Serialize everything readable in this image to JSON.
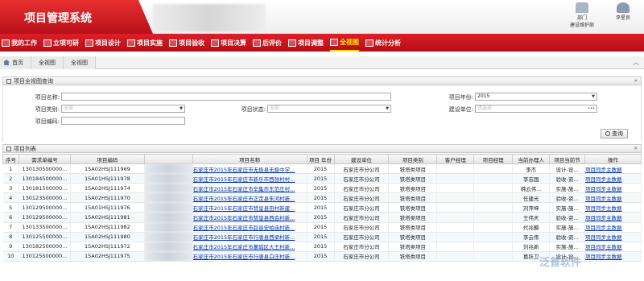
{
  "app": {
    "title": "项目管理系统"
  },
  "top_links": [
    {
      "label": "部门",
      "sub": "建设维护部"
    },
    {
      "label": "李星良",
      "sub": ""
    }
  ],
  "nav": [
    {
      "label": "我的工作"
    },
    {
      "label": "立项可研"
    },
    {
      "label": "项目设计"
    },
    {
      "label": "项目实施"
    },
    {
      "label": "项目验收"
    },
    {
      "label": "项目决算"
    },
    {
      "label": "后评价"
    },
    {
      "label": "项目调整"
    },
    {
      "label": "全视图"
    },
    {
      "label": "统计分析"
    }
  ],
  "breadcrumb": {
    "home": "首页",
    "tab1": "全视图",
    "tab2": "全视图"
  },
  "query": {
    "title": "项目全视图查询",
    "name_label": "项目名称:",
    "type_label": "项目类别:",
    "type_value": "全部",
    "status_label": "项目状态:",
    "status_value": "全部",
    "code_label": "项目编码:",
    "year_label": "项目年份:",
    "year_value": "2015",
    "unit_label": "建设单位:",
    "unit_placeholder": "请选择",
    "button": "查询"
  },
  "table": {
    "title": "项目列表",
    "columns": [
      "序号",
      "需求单编号",
      "项目编码",
      "",
      "项目名称",
      "项目 年份",
      "建设单位",
      "项目类别",
      "客户经理",
      "项目经理",
      "当前办理人",
      "项目当前节",
      "操作"
    ],
    "rows": [
      [
        "1",
        "130130500000...",
        "15A02HSJ111969",
        "",
        "石家庄市2015年石家庄市无极县无极中学...",
        "2015",
        "石家庄市分公司",
        "铁塔类项目",
        "",
        "",
        "李杰",
        "设计-设...",
        "项目同步主数据"
      ],
      [
        "2",
        "130184500000...",
        "15A01HSJ111978",
        "",
        "石家庄市2015年石家庄市新乐市西张村村...",
        "2015",
        "石家庄市分公司",
        "铁塔类项目",
        "",
        "",
        "李志国",
        "验收-资...",
        "项目同步主数据"
      ],
      [
        "3",
        "130181500000...",
        "15A02HSJ111974",
        "",
        "石家庄市2015年石家庄市辛集市东范庄村...",
        "2015",
        "石家庄市分公司",
        "铁塔类项目",
        "",
        "",
        "韩云伟...",
        "实施-施...",
        "项目同步主数据"
      ],
      [
        "4",
        "130123500000...",
        "15A02HSJ111970",
        "",
        "石家庄市2015年石家庄市正定县朱河村新...",
        "2015",
        "石家庄市分公司",
        "铁塔类项目",
        "",
        "",
        "任建光",
        "验收-资...",
        "项目同步主数据"
      ],
      [
        "5",
        "130129500000...",
        "15A01HSJ111976",
        "",
        "石家庄市2015年石家庄市赞皇县田村新建...",
        "2015",
        "石家庄市分公司",
        "铁塔类项目",
        "",
        "",
        "刘萍坤",
        "实施-施...",
        "项目同步主数据"
      ],
      [
        "6",
        "130129500000...",
        "15A02HSJ111981",
        "",
        "石家庄市2015年石家庄市赞皇县西会村新...",
        "2015",
        "石家庄市分公司",
        "铁塔类项目",
        "",
        "",
        "王伟天",
        "验收-资...",
        "项目同步主数据"
      ],
      [
        "7",
        "130133500000...",
        "15A02HSJ111982",
        "",
        "石家庄市2015年石家庄市赵县安柏庙村新...",
        "2015",
        "石家庄市分公司",
        "铁塔类项目",
        "",
        "",
        "代兆麟",
        "实施-施...",
        "项目同步主数据"
      ],
      [
        "8",
        "130125500000...",
        "15A02HSJ111980",
        "",
        "石家庄市2015年石家庄市行唐县西梁村新...",
        "2015",
        "石家庄市分公司",
        "铁塔类项目",
        "",
        "",
        "李云伟",
        "验收-资...",
        "项目同步主数据"
      ],
      [
        "9",
        "130182500000...",
        "15A02HSJ111972",
        "",
        "石家庄市2015年石家庄市藁城区大王村新...",
        "2015",
        "石家庄市分公司",
        "铁塔类项目",
        "",
        "",
        "刘兆新",
        "实施-施...",
        "项目同步主数据"
      ],
      [
        "10",
        "130125500000...",
        "15A02HSJ111975",
        "",
        "石家庄市2015年石家庄市行唐县白庄村新...",
        "2015",
        "石家庄市分公司",
        "铁塔类项目",
        "",
        "",
        "葛跃卫",
        "设计-设...",
        "项目同步主数据"
      ]
    ]
  }
}
